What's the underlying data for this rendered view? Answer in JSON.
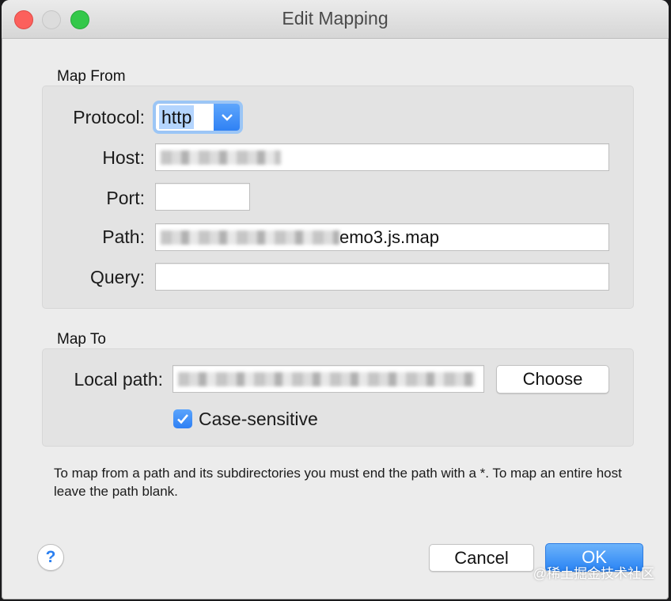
{
  "window": {
    "title": "Edit Mapping"
  },
  "map_from": {
    "section_label": "Map From",
    "protocol_label": "Protocol:",
    "protocol_value": "http",
    "host_label": "Host:",
    "host_value": "",
    "port_label": "Port:",
    "port_value": "",
    "path_label": "Path:",
    "path_visible_suffix": "emo3.js.map",
    "query_label": "Query:",
    "query_value": ""
  },
  "map_to": {
    "section_label": "Map To",
    "local_path_label": "Local path:",
    "local_path_value": "",
    "choose_label": "Choose",
    "case_sensitive_label": "Case-sensitive",
    "case_sensitive_checked": true
  },
  "hint_text": "To map from a path and its subdirectories you must end the path with a *. To map an entire host leave the path blank.",
  "footer": {
    "help_label": "?",
    "cancel_label": "Cancel",
    "ok_label": "OK"
  },
  "watermark": "@稀土掘金技术社区",
  "colors": {
    "accent": "#2f81f4",
    "window_bg": "#ececec",
    "group_bg": "#e3e3e3"
  }
}
